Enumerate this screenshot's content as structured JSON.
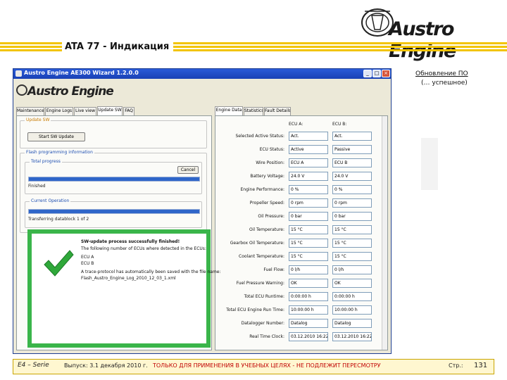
{
  "slide": {
    "title": "ATA 77 - Индикация",
    "logo_text": "Austro Engine",
    "caption_title": "Обновление ПО",
    "caption_sub": "(… успешное)"
  },
  "footer": {
    "serie": "E4 – Serie",
    "issue": "Выпуск: 3.1 декабря 2010 г.",
    "warning": "ТОЛЬКО ДЛЯ ПРИМЕНЕНИЯ В УЧЕБНЫХ ЦЕЛЯХ - НЕ ПОДЛЕЖИТ ПЕРЕСМОТРУ",
    "page_label": "Стр.:",
    "page_number": "131"
  },
  "window": {
    "title": "Austro Engine AE300 Wizard 1.2.0.0",
    "logo": "Austro Engine",
    "buttons": {
      "minimize": "_",
      "maximize": "□",
      "close": "×"
    }
  },
  "left_tabs": [
    "Maintenance",
    "Engine Logs",
    "Live view",
    "Update SW",
    "FAQ"
  ],
  "left_active_tab": 3,
  "right_tabs": [
    "Engine Data",
    "Statistics",
    "Fault Details"
  ],
  "right_active_tab": 0,
  "update": {
    "group_label": "Update SW",
    "start_button": "Start SW Update",
    "flash_group": "Flash programming information",
    "total_group": "Total progress",
    "cancel_button": "Cancel",
    "total_status": "Finished",
    "total_progress": 100,
    "current_group": "Current Operation",
    "current_status": "Transferring datablock 1 of 2",
    "current_progress": 100
  },
  "message": {
    "title": "SW-update process successfully finished!",
    "line1": "The following number of ECUs where detected in the ECUs:",
    "ecu_a": "ECU A",
    "ecu_b": "ECU B",
    "line2": "A trace-protocol has automatically been saved with the file name:",
    "file": "Flash_Austro_Engine_Log_2010_12_03_1.xml"
  },
  "ecu": {
    "col_a": "ECU A:",
    "col_b": "ECU B:",
    "rows": [
      {
        "label": "Selected Active Status:",
        "a": "Act.",
        "b": "Act."
      },
      {
        "label": "ECU Status:",
        "a": "Active",
        "b": "Passive"
      },
      {
        "label": "Wire Position:",
        "a": "ECU A",
        "b": "ECU B"
      },
      {
        "label": "Battery Voltage:",
        "a": "24.0 V",
        "b": "24.0 V"
      },
      {
        "label": "Engine Performance:",
        "a": "0 %",
        "b": "0 %"
      },
      {
        "label": "Propeller Speed:",
        "a": "0 rpm",
        "b": "0 rpm"
      },
      {
        "label": "Oil Pressure:",
        "a": "0 bar",
        "b": "0 bar"
      },
      {
        "label": "Oil Temperature:",
        "a": "15 °C",
        "b": "15 °C"
      },
      {
        "label": "Gearbox Oil Temperature:",
        "a": "15 °C",
        "b": "15 °C"
      },
      {
        "label": "Coolant Temperature:",
        "a": "15 °C",
        "b": "15 °C"
      },
      {
        "label": "Fuel Flow:",
        "a": "0 l/h",
        "b": "0 l/h"
      },
      {
        "label": "Fuel Pressure Warning:",
        "a": "OK",
        "b": "OK"
      },
      {
        "label": "Total ECU Runtime:",
        "a": "0:00:00 h",
        "b": "0:00:00 h"
      },
      {
        "label": "Total ECU Engine Run Time:",
        "a": "10:00:00 h",
        "b": "10:00:00 h"
      },
      {
        "label": "Datalogger Number:",
        "a": "Datalog",
        "b": "Datalog"
      },
      {
        "label": "Real Time Clock:",
        "a": "03.12.2010 16:22 UTC",
        "b": "03.12.2010 16:22 UTC"
      }
    ]
  },
  "colors": {
    "accent_yellow": "#f2c400",
    "title_bar": "#2a5bd8",
    "progress": "#2f66c9",
    "success_green": "#3ab54a",
    "warning_red": "#c00000"
  }
}
